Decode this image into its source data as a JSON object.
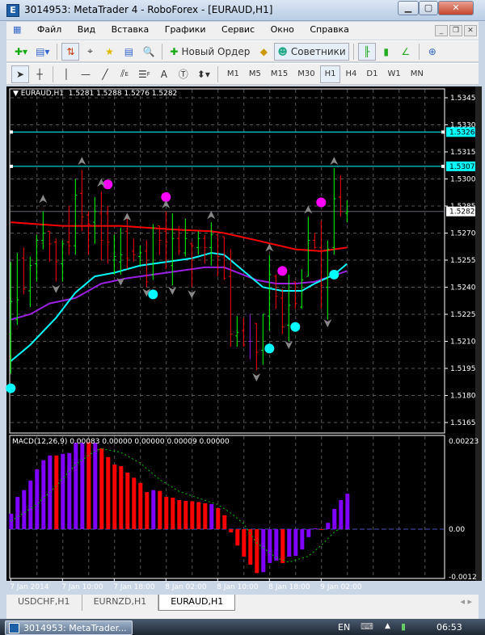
{
  "window": {
    "title": "3014953: MetaTrader 4 - RoboForex - [EURAUD,H1]",
    "app_icon": "metatrader-icon"
  },
  "menu": [
    "Файл",
    "Вид",
    "Вставка",
    "Графики",
    "Сервис",
    "Окно",
    "Справка"
  ],
  "toolbar1": {
    "new_order": "Новый Ордер",
    "experts": "Советники"
  },
  "toolbar2": {
    "text_tool": "A",
    "timeframes": [
      "M1",
      "M5",
      "M15",
      "M30",
      "H1",
      "H4",
      "D1",
      "W1",
      "MN"
    ],
    "active_timeframe": "H1",
    "fibo_e": "E",
    "fibo_f": "F"
  },
  "chart_header": {
    "symbol": "EURAUD,H1",
    "ohlc": "1.5281 1.5288 1.5276 1.5282"
  },
  "macd_header": "MACD(12,26,9) 0.00083 0.00000 0.00000 0.00009 0.00000",
  "tabs": [
    "USDCHF,H1",
    "EURNZD,H1",
    "EURAUD,H1"
  ],
  "active_tab": 2,
  "taskbar": {
    "item": "3014953: MetaTrader...",
    "lang": "EN",
    "clock": "06:53"
  },
  "colors": {
    "bull": "#00ff00",
    "bear": "#ff0000",
    "ma_slow": "#ff0000",
    "ma_fast": "#00ffff",
    "ma_mid": "#9b1fe0",
    "macd_up": "#8000ff",
    "macd_down": "#ff0000",
    "signal": "#00c000",
    "hline": "#00ffff"
  },
  "chart_data": [
    {
      "type": "ohlc",
      "title": "EURAUD,H1",
      "ylim": [
        1.516,
        1.535
      ],
      "y_ticks": [
        "1.5345",
        "1.5330",
        "1.5315",
        "1.5300",
        "1.5285",
        "1.5270",
        "1.5255",
        "1.5240",
        "1.5225",
        "1.5210",
        "1.5195",
        "1.5180",
        "1.5165"
      ],
      "x_ticks": [
        "7 Jan 2014",
        "7 Jan 10:00",
        "7 Jan 18:00",
        "8 Jan 02:00",
        "8 Jan 10:00",
        "8 Jan 18:00",
        "9 Jan 02:00"
      ],
      "bars": [
        [
          1.5214,
          1.5254,
          1.5192,
          1.5232
        ],
        [
          1.5222,
          1.5259,
          1.5219,
          1.5233
        ],
        [
          1.5256,
          1.5262,
          1.5236,
          1.5239
        ],
        [
          1.5238,
          1.5257,
          1.5229,
          1.5252
        ],
        [
          1.5253,
          1.5269,
          1.5243,
          1.5266
        ],
        [
          1.5266,
          1.5282,
          1.5261,
          1.527
        ],
        [
          1.5271,
          1.5271,
          1.5254,
          1.5264
        ],
        [
          1.5265,
          1.5267,
          1.5243,
          1.5254
        ],
        [
          1.5253,
          1.5266,
          1.5243,
          1.5264
        ],
        [
          1.5265,
          1.5285,
          1.5258,
          1.5263
        ],
        [
          1.5263,
          1.53,
          1.5258,
          1.5291
        ],
        [
          1.5292,
          1.5305,
          1.5271,
          1.5279
        ],
        [
          1.528,
          1.5282,
          1.5258,
          1.5275
        ],
        [
          1.5276,
          1.529,
          1.5264,
          1.5282
        ],
        [
          1.5281,
          1.5293,
          1.5255,
          1.5266
        ],
        [
          1.5281,
          1.5285,
          1.5253,
          1.5265
        ],
        [
          1.5255,
          1.5269,
          1.5247,
          1.5257
        ],
        [
          1.5254,
          1.5273,
          1.5247,
          1.5258
        ],
        [
          1.5271,
          1.5279,
          1.525,
          1.5256
        ],
        [
          1.526,
          1.5267,
          1.5254,
          1.5258
        ],
        [
          1.5257,
          1.5263,
          1.5252,
          1.5259
        ],
        [
          1.526,
          1.5266,
          1.524,
          1.5243
        ],
        [
          1.5247,
          1.5275,
          1.5244,
          1.5273
        ],
        [
          1.5274,
          1.5274,
          1.5258,
          1.5266
        ],
        [
          1.5271,
          1.5282,
          1.525,
          1.5265
        ],
        [
          1.5252,
          1.5281,
          1.5241,
          1.5267
        ],
        [
          1.5267,
          1.5274,
          1.5258,
          1.526
        ],
        [
          1.5259,
          1.5278,
          1.5257,
          1.5267
        ],
        [
          1.5264,
          1.5265,
          1.524,
          1.5263
        ],
        [
          1.5262,
          1.5271,
          1.5258,
          1.5267
        ],
        [
          1.5267,
          1.5269,
          1.5253,
          1.5262
        ],
        [
          1.5262,
          1.5276,
          1.5252,
          1.5269
        ],
        [
          1.5269,
          1.5269,
          1.5246,
          1.5257
        ],
        [
          1.5268,
          1.5268,
          1.5244,
          1.5245
        ],
        [
          1.5246,
          1.5261,
          1.5207,
          1.5214
        ],
        [
          1.5213,
          1.5224,
          1.5207,
          1.5215
        ],
        [
          1.5216,
          1.5223,
          1.5207,
          1.5208
        ],
        [
          1.521,
          1.5225,
          1.52,
          1.521
        ],
        [
          1.522,
          1.522,
          1.5194,
          1.5204
        ],
        [
          1.5205,
          1.5225,
          1.5197,
          1.5225
        ],
        [
          1.5224,
          1.5258,
          1.5216,
          1.5247
        ],
        [
          1.5246,
          1.5247,
          1.5228,
          1.5235
        ],
        [
          1.5234,
          1.5239,
          1.5214,
          1.5218
        ],
        [
          1.5219,
          1.5247,
          1.521,
          1.523
        ],
        [
          1.5243,
          1.5243,
          1.5228,
          1.5231
        ],
        [
          1.5229,
          1.525,
          1.5228,
          1.5244
        ],
        [
          1.5246,
          1.5279,
          1.5246,
          1.5266
        ],
        [
          1.5266,
          1.527,
          1.5261,
          1.5262
        ],
        [
          1.5262,
          1.5277,
          1.5228,
          1.5241
        ],
        [
          1.524,
          1.5266,
          1.5222,
          1.5261
        ],
        [
          1.5262,
          1.5306,
          1.5258,
          1.5289
        ],
        [
          1.529,
          1.5302,
          1.5279,
          1.5282
        ],
        [
          1.5281,
          1.5288,
          1.5276,
          1.5282
        ]
      ],
      "ma_slow": [
        [
          0,
          1.5276
        ],
        [
          8,
          1.5274
        ],
        [
          17,
          1.5274
        ],
        [
          25,
          1.5272
        ],
        [
          31,
          1.5271
        ],
        [
          33,
          1.527
        ],
        [
          38,
          1.5266
        ],
        [
          44,
          1.5261
        ],
        [
          48,
          1.526
        ],
        [
          52,
          1.5262
        ]
      ],
      "ma_fast": [
        [
          0,
          1.5199
        ],
        [
          3,
          1.5208
        ],
        [
          7,
          1.5223
        ],
        [
          10,
          1.5237
        ],
        [
          13,
          1.5246
        ],
        [
          16,
          1.5248
        ],
        [
          20,
          1.5252
        ],
        [
          24,
          1.5254
        ],
        [
          28,
          1.5256
        ],
        [
          31,
          1.5259
        ],
        [
          33,
          1.5258
        ],
        [
          36,
          1.5249
        ],
        [
          39,
          1.524
        ],
        [
          42,
          1.5238
        ],
        [
          45,
          1.5238
        ],
        [
          47,
          1.5242
        ],
        [
          50,
          1.5247
        ],
        [
          52,
          1.5253
        ]
      ],
      "ma_mid": [
        [
          0,
          1.5222
        ],
        [
          3,
          1.5225
        ],
        [
          6,
          1.5231
        ],
        [
          10,
          1.5234
        ],
        [
          14,
          1.5242
        ],
        [
          18,
          1.5245
        ],
        [
          22,
          1.5247
        ],
        [
          26,
          1.5249
        ],
        [
          30,
          1.5251
        ],
        [
          33,
          1.5251
        ],
        [
          38,
          1.5244
        ],
        [
          41,
          1.5242
        ],
        [
          44,
          1.5242
        ],
        [
          47,
          1.5243
        ],
        [
          52,
          1.5249
        ]
      ],
      "dots_magenta": [
        [
          15,
          1.5297
        ],
        [
          24,
          1.529
        ],
        [
          42,
          1.5249
        ],
        [
          48,
          1.5287
        ]
      ],
      "dots_cyan": [
        [
          0,
          1.5184
        ],
        [
          22,
          1.5236
        ],
        [
          40,
          1.5206
        ],
        [
          44,
          1.5218
        ],
        [
          50,
          1.5247
        ]
      ],
      "fractals_up": [
        [
          5,
          1.5289
        ],
        [
          11,
          1.531
        ],
        [
          14,
          1.5298
        ],
        [
          18,
          1.5279
        ],
        [
          24,
          1.5286
        ],
        [
          31,
          1.528
        ],
        [
          40,
          1.5262
        ],
        [
          46,
          1.5283
        ],
        [
          50,
          1.531
        ]
      ],
      "fractals_down": [
        [
          7,
          1.5239
        ],
        [
          17,
          1.5243
        ],
        [
          21,
          1.5237
        ],
        [
          25,
          1.5238
        ],
        [
          28,
          1.5236
        ],
        [
          38,
          1.519
        ],
        [
          43,
          1.5208
        ],
        [
          49,
          1.522
        ]
      ],
      "hlines": [
        {
          "price": 1.5326,
          "label": "1.5326"
        },
        {
          "price": 1.5307,
          "label": "1.5307"
        }
      ],
      "current_price": {
        "price": 1.5282,
        "label": "1.5282"
      }
    },
    {
      "type": "bar",
      "title": "MACD(12,26,9)",
      "ylim": [
        -0.0012,
        0.00223
      ],
      "y_ticks": [
        "0.00223",
        "0.00",
        "-0.0012"
      ],
      "values": [
        0.00039,
        0.00081,
        0.00098,
        0.00122,
        0.0015,
        0.00173,
        0.00185,
        0.00185,
        0.00189,
        0.00191,
        0.00217,
        0.00217,
        0.00218,
        0.00217,
        0.00203,
        0.00181,
        0.00162,
        0.00158,
        0.00142,
        0.00129,
        0.00116,
        0.00093,
        0.00098,
        0.00096,
        0.00081,
        0.00079,
        0.00073,
        0.00071,
        0.0007,
        0.00068,
        0.00065,
        0.00063,
        0.00053,
        0.00035,
        -8e-05,
        -0.00041,
        -0.00069,
        -0.00089,
        -0.0011,
        -0.00108,
        -0.00085,
        -0.00079,
        -0.00085,
        -0.00069,
        -0.00067,
        -0.00051,
        -0.0002,
        2e-05,
        -1e-05,
        0.00016,
        0.00051,
        0.00073,
        0.00089
      ],
      "colors": [
        "up",
        "up",
        "up",
        "up",
        "up",
        "up",
        "up",
        "down",
        "up",
        "up",
        "up",
        "up",
        "down",
        "up",
        "down",
        "down",
        "down",
        "down",
        "down",
        "down",
        "down",
        "down",
        "up",
        "down",
        "down",
        "down",
        "down",
        "down",
        "down",
        "down",
        "down",
        "up",
        "down",
        "down",
        "down",
        "down",
        "down",
        "down",
        "down",
        "up",
        "up",
        "up",
        "down",
        "up",
        "up",
        "up",
        "up",
        "up",
        "down",
        "up",
        "up",
        "up",
        "up"
      ],
      "signal": [
        [
          0,
          0.0002
        ],
        [
          4,
          0.00061
        ],
        [
          7,
          0.00108
        ],
        [
          10,
          0.00162
        ],
        [
          13,
          0.00196
        ],
        [
          14,
          0.00202
        ],
        [
          17,
          0.00193
        ],
        [
          20,
          0.00166
        ],
        [
          23,
          0.00125
        ],
        [
          26,
          0.00095
        ],
        [
          29,
          0.00078
        ],
        [
          32,
          0.00062
        ],
        [
          34,
          0.00041
        ],
        [
          36,
          0.00014
        ],
        [
          38,
          -0.00034
        ],
        [
          41,
          -0.00071
        ],
        [
          43,
          -0.00083
        ],
        [
          46,
          -0.00068
        ],
        [
          48,
          -0.00041
        ],
        [
          50,
          -8e-05
        ],
        [
          51,
          3e-05
        ]
      ]
    }
  ]
}
